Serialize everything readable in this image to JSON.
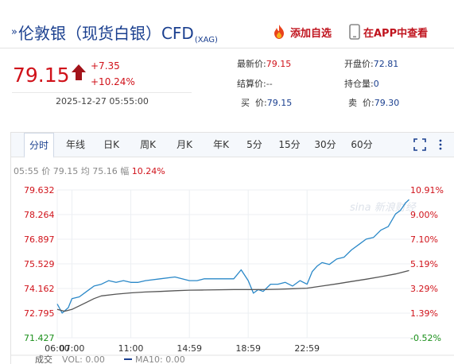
{
  "header": {
    "title_mark": "»",
    "title": "伦敦银（现货白银）CFD",
    "title_sub": "(XAG)",
    "add_watch_label": "添加自选",
    "app_view_label": "在APP中查看"
  },
  "quote": {
    "price": "79.15",
    "change": "+7.35",
    "change_pct": "+10.24%",
    "timestamp": "2025-12-27 05:55:00",
    "latest_label": "最新价:",
    "latest_value": "79.15",
    "open_label": "开盘价:",
    "open_value": "72.81",
    "settle_label": "结算价:",
    "settle_value": "--",
    "position_label": "持仓量:",
    "position_value": "0",
    "bid_label": "买  价:",
    "bid_value": "79.15",
    "ask_label": "卖  价:",
    "ask_value": "79.30"
  },
  "tabs": [
    "分时",
    "年线",
    "日K",
    "周K",
    "月K",
    "年K",
    "5分",
    "15分",
    "30分",
    "60分"
  ],
  "info_bar": {
    "time": "05:55",
    "price_label": "价",
    "price": "79.15",
    "avg_label": "均",
    "avg": "75.16",
    "amp_label": "幅",
    "amp": "10.24%"
  },
  "watermark": "sina 新浪财经",
  "volume_bar": {
    "label": "成交",
    "vol": "VOL: 0.00",
    "ma": "MA10: 0.00"
  },
  "colors": {
    "up": "#d0121a",
    "down": "#1a8f1a",
    "price_line": "#2a88c8",
    "avg_line": "#555555",
    "brand": "#1a3f8f"
  },
  "chart_data": {
    "type": "line",
    "y_left_ticks": [
      "79.632",
      "78.264",
      "76.897",
      "75.529",
      "74.162",
      "72.795",
      "71.427"
    ],
    "y_right_ticks": [
      "10.91%",
      "9.00%",
      "7.10%",
      "5.19%",
      "3.29%",
      "1.39%",
      "-0.52%"
    ],
    "x_ticks": [
      "07:00",
      "11:00",
      "14:59",
      "18:59",
      "22:59",
      "06:00"
    ],
    "ylim": [
      71.427,
      79.632
    ],
    "series": [
      {
        "name": "价",
        "x": [
          "06:00",
          "06:20",
          "06:45",
          "07:00",
          "07:30",
          "08:00",
          "08:30",
          "09:00",
          "09:30",
          "10:00",
          "10:30",
          "11:00",
          "11:30",
          "12:00",
          "13:00",
          "14:00",
          "14:59",
          "15:30",
          "16:00",
          "17:00",
          "18:00",
          "18:30",
          "18:59",
          "19:20",
          "19:40",
          "20:00",
          "20:30",
          "21:00",
          "21:30",
          "22:00",
          "22:30",
          "22:59",
          "23:20",
          "23:40",
          "00:00",
          "00:30",
          "01:00",
          "01:30",
          "02:00",
          "02:30",
          "03:00",
          "03:30",
          "04:00",
          "04:30",
          "05:00",
          "05:20",
          "05:40",
          "05:55"
        ],
        "values": [
          73.3,
          72.8,
          73.1,
          73.6,
          73.7,
          74.0,
          74.3,
          74.4,
          74.6,
          74.5,
          74.6,
          74.5,
          74.5,
          74.6,
          74.7,
          74.8,
          74.6,
          74.6,
          74.7,
          74.7,
          74.7,
          75.2,
          74.6,
          73.9,
          74.1,
          74.0,
          74.4,
          74.4,
          74.5,
          74.3,
          74.6,
          74.4,
          75.1,
          75.4,
          75.6,
          75.5,
          75.8,
          75.9,
          76.3,
          76.6,
          76.9,
          77.0,
          77.4,
          77.6,
          78.3,
          78.5,
          78.9,
          79.1
        ]
      },
      {
        "name": "均",
        "x": [
          "06:00",
          "06:30",
          "07:00",
          "07:30",
          "08:00",
          "08:30",
          "09:00",
          "10:00",
          "11:00",
          "12:00",
          "13:00",
          "14:00",
          "15:00",
          "16:00",
          "17:00",
          "18:00",
          "19:00",
          "20:00",
          "21:00",
          "22:00",
          "22:59",
          "00:00",
          "01:00",
          "02:00",
          "03:00",
          "04:00",
          "05:00",
          "05:55"
        ],
        "values": [
          73.0,
          72.9,
          73.0,
          73.2,
          73.4,
          73.6,
          73.75,
          73.85,
          73.92,
          73.97,
          74.0,
          74.04,
          74.07,
          74.08,
          74.09,
          74.1,
          74.1,
          74.1,
          74.12,
          74.15,
          74.18,
          74.3,
          74.42,
          74.55,
          74.68,
          74.82,
          74.97,
          75.16
        ]
      }
    ]
  }
}
